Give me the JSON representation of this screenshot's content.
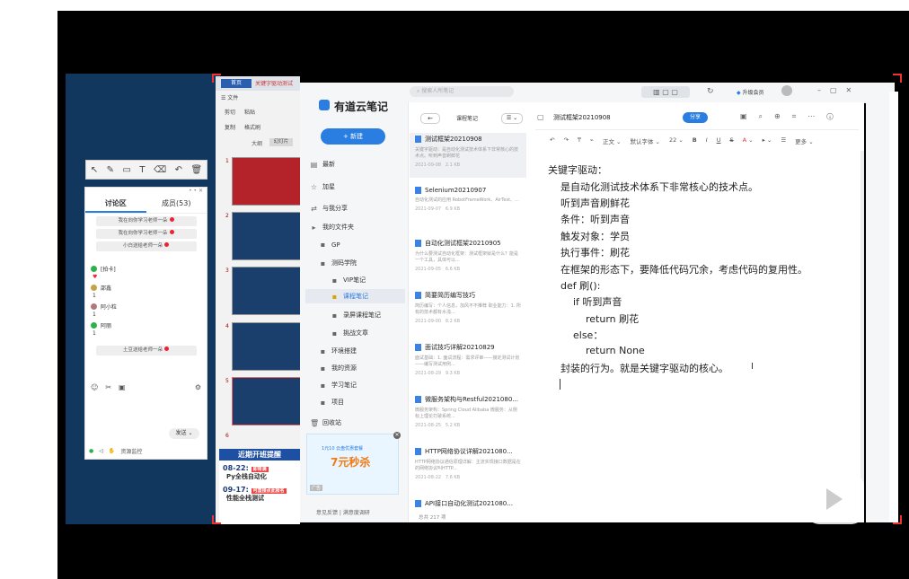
{
  "classroom": {
    "chat_tabs": [
      "讨论区",
      "成员(53)"
    ],
    "messages": [
      "我在向你学习老师一朵",
      "我在向你学习老师一朵",
      "小白送给老师一朵"
    ],
    "users": [
      {
        "name": "[拍卡]",
        "count": ""
      },
      {
        "name": "邵鑫",
        "count": "1"
      },
      {
        "name": "阿小粒",
        "count": "1"
      },
      {
        "name": "阿丽",
        "count": "1"
      }
    ],
    "last_message": "土豆送给老师一朵",
    "send_label": "发送",
    "status_label": "资源监控"
  },
  "ppt": {
    "tab_home": "首页",
    "tab_doc": "关键字驱动测试",
    "menu_file": "文件",
    "toolbar": [
      "剪切",
      "粘贴",
      "复制",
      "格式刷"
    ],
    "zoom_label": "大纲",
    "slide_label": "幻灯片",
    "slide_numbers": [
      "1",
      "2",
      "3",
      "4",
      "5",
      "6"
    ]
  },
  "ad_left": {
    "title": "近期开班提醒",
    "items": [
      {
        "date": "08-22:",
        "tag": "即将满",
        "course": "Py全栈自动化"
      },
      {
        "date": "09-17:",
        "tag": "可直接点此报名",
        "course": "性能全栈测试"
      }
    ]
  },
  "app": {
    "name": "有道云笔记",
    "search_placeholder": "搜索人所笔记",
    "upgrade": "升级会员",
    "new_button": "+ 新建",
    "nav": [
      "最新",
      "加星",
      "与我分享",
      "我的文件夹",
      "GP",
      "测码学院",
      "VIP笔记",
      "课程笔记",
      "录屏课程笔记",
      "挑战文章",
      "环境搭建",
      "我的资源",
      "学习笔记",
      "项目",
      "回收站"
    ],
    "feedback": "意见反馈",
    "survey": "满意度调研",
    "ad_text": "7元秒杀",
    "ad_sub": "1元10 云盘优惠套餐",
    "ad_tag": "广告"
  },
  "list": {
    "folder_title": "课程笔记",
    "total": "总共 217 项",
    "notes": [
      {
        "title": "测试框架20210908",
        "snippet": "关键字驱动：是自动化测试技术体系下非常核心的技术点。听到声音刷鲜花",
        "date": "2021-09-08",
        "size": "2.1 KB"
      },
      {
        "title": "Selenium20210907",
        "snippet": "自动化测试的应用 RobotFrameWork、AirTest、...",
        "date": "2021-09-07",
        "size": "6.9 KB"
      },
      {
        "title": "自动化测试框架20210905",
        "snippet": "为什么要测试自动化框架：测试框架就是什么？能是一个工具，具体可以...",
        "date": "2021-09-05",
        "size": "6.6 KB"
      },
      {
        "title": "简要简历编写技巧",
        "snippet": "简历编写：个人信息，加风不不推荐 职业能力：1. 所有的技术都有水浅...",
        "date": "2021-09-00",
        "size": "8.2 KB"
      },
      {
        "title": "面试技巧详解20210829",
        "snippet": "面试基础：1. 面试流程：需求评审——接定测试计划——编写测试用例...",
        "date": "2021-08-29",
        "size": "9.3 KB"
      },
      {
        "title": "微服务架构与Restful2021080...",
        "snippet": "微服务架构：Spring Cloud Alibaba 微服务：从侧标上理论打破系统...",
        "date": "2021-08-25",
        "size": "5.2 KB"
      },
      {
        "title": "HTTP网络协议详解2021080...",
        "snippet": "HTTP网络协议通信原理详解：主流实现接口数据是在的网络协议叫HTTP...",
        "date": "2021-08-22",
        "size": "7.6 KB"
      },
      {
        "title": "API接口自动化测试2021080...",
        "snippet": "",
        "date": "",
        "size": ""
      }
    ]
  },
  "editor": {
    "title": "测试框架20210908",
    "share": "分享",
    "format": [
      "正文",
      "默认字体",
      "22",
      "B",
      "I",
      "U",
      "S",
      "A",
      "更多"
    ],
    "lines": [
      "关键字驱动：",
      "是自动化测试技术体系下非常核心的技术点。",
      "听到声音刷鲜花",
      "条件：听到声音",
      "触发对象：学员",
      "执行事件：刷花",
      "在框架的形态下，要降低代码冗余，考虑代码的复用性。",
      "def 刷():",
      "if 听到声音",
      "return 刷花",
      "else：",
      "return None",
      "封装的行为。就是关键字驱动的核心。"
    ]
  },
  "colors": {
    "accent": "#2a7de1",
    "dark_bg": "#12375f",
    "frame": "#e33333"
  }
}
